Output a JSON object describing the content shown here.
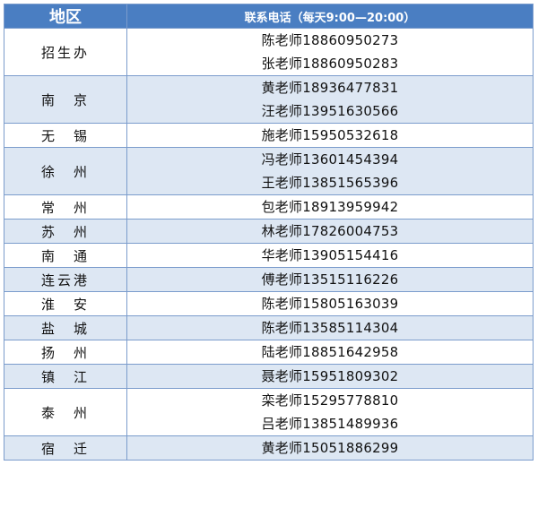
{
  "header": {
    "region_label": "地区",
    "phone_label": "联系电话（每天9:00—20:00）"
  },
  "rows": [
    {
      "region": "招生办",
      "contacts": [
        "陈老师18860950273",
        "张老师18860950283"
      ]
    },
    {
      "region": "南　京",
      "contacts": [
        "黄老师18936477831",
        "汪老师13951630566"
      ]
    },
    {
      "region": "无　锡",
      "contacts": [
        "施老师15950532618"
      ]
    },
    {
      "region": "徐　州",
      "contacts": [
        "冯老师13601454394",
        "王老师13851565396"
      ]
    },
    {
      "region": "常　州",
      "contacts": [
        "包老师18913959942"
      ]
    },
    {
      "region": "苏　州",
      "contacts": [
        "林老师17826004753"
      ]
    },
    {
      "region": "南　通",
      "contacts": [
        "华老师13905154416"
      ]
    },
    {
      "region": "连云港",
      "contacts": [
        "傅老师13515116226"
      ]
    },
    {
      "region": "淮　安",
      "contacts": [
        "陈老师15805163039"
      ]
    },
    {
      "region": "盐　城",
      "contacts": [
        "陈老师13585114304"
      ]
    },
    {
      "region": "扬　州",
      "contacts": [
        "陆老师18851642958"
      ]
    },
    {
      "region": "镇　江",
      "contacts": [
        "聂老师15951809302"
      ]
    },
    {
      "region": "泰　州",
      "contacts": [
        "栾老师15295778810",
        "吕老师13851489936"
      ]
    },
    {
      "region": "宿　迁",
      "contacts": [
        "黄老师15051886299"
      ]
    }
  ],
  "colors": {
    "header_bg": "#4a7ec2",
    "band_bg": "#dde7f3",
    "border": "#7b9ccc"
  }
}
